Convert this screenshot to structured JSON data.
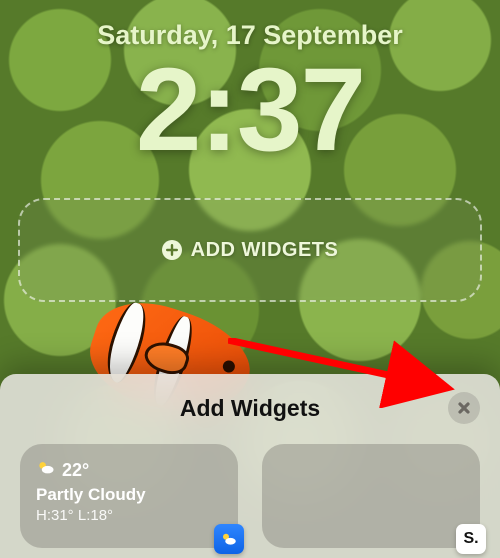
{
  "lockscreen": {
    "date": "Saturday, 17 September",
    "time": "2:37",
    "add_widgets_label": "ADD WIDGETS"
  },
  "panel": {
    "title": "Add Widgets",
    "close_icon": "close-icon",
    "cards": [
      {
        "kind": "weather",
        "icon": "partly-cloudy-icon",
        "temp": "22°",
        "condition": "Partly Cloudy",
        "hi_lo": "H:31° L:18°",
        "app": "Weather"
      },
      {
        "kind": "generic",
        "app_badge_text": "S."
      }
    ]
  },
  "annotation": {
    "arrow_color": "#ff0000"
  }
}
